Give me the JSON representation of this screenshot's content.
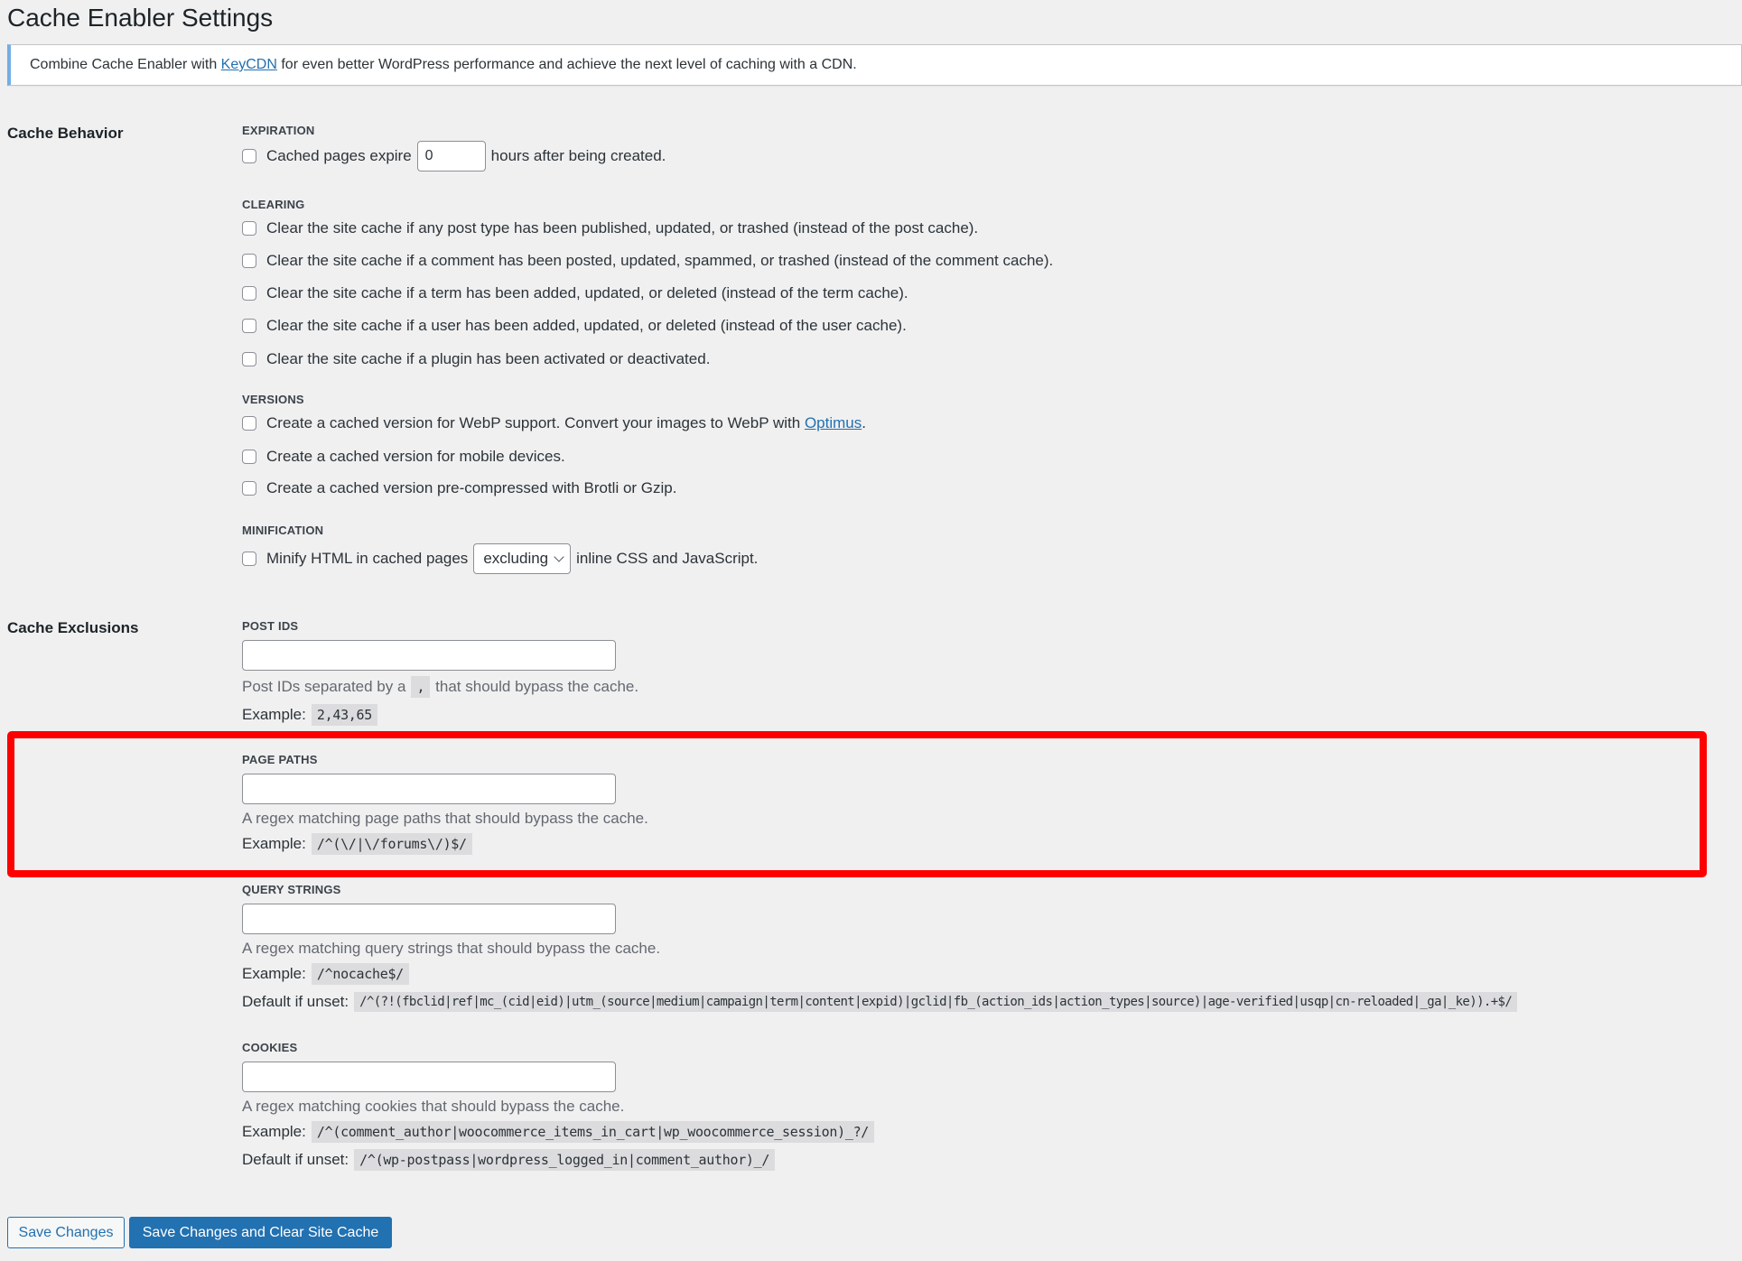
{
  "page": {
    "title": "Cache Enabler Settings"
  },
  "notice": {
    "before": "Combine Cache Enabler with ",
    "link": "KeyCDN",
    "after": " for even better WordPress performance and achieve the next level of caching with a CDN."
  },
  "cache_behavior": {
    "heading": "Cache Behavior",
    "expiration": {
      "label": "EXPIRATION",
      "before": "Cached pages expire",
      "value": "0",
      "after": "hours after being created.",
      "checked": false
    },
    "clearing": {
      "label": "CLEARING",
      "items": [
        {
          "label": "Clear the site cache if any post type has been published, updated, or trashed (instead of the post cache).",
          "checked": false
        },
        {
          "label": "Clear the site cache if a comment has been posted, updated, spammed, or trashed (instead of the comment cache).",
          "checked": false
        },
        {
          "label": "Clear the site cache if a term has been added, updated, or deleted (instead of the term cache).",
          "checked": false
        },
        {
          "label": "Clear the site cache if a user has been added, updated, or deleted (instead of the user cache).",
          "checked": false
        },
        {
          "label": "Clear the site cache if a plugin has been activated or deactivated.",
          "checked": false
        }
      ]
    },
    "versions": {
      "label": "VERSIONS",
      "webp_before": "Create a cached version for WebP support. Convert your images to WebP with ",
      "webp_link": "Optimus",
      "webp_after": ".",
      "mobile": "Create a cached version for mobile devices.",
      "compressed": "Create a cached version pre-compressed with Brotli or Gzip."
    },
    "minification": {
      "label": "MINIFICATION",
      "before": "Minify HTML in cached pages",
      "selected": "excluding",
      "after": "inline CSS and JavaScript.",
      "checked": false
    }
  },
  "cache_exclusions": {
    "heading": "Cache Exclusions",
    "post_ids": {
      "label": "POST IDS",
      "value": "",
      "desc_before": "Post IDs separated by a",
      "separator": ",",
      "desc_after": "that should bypass the cache.",
      "example_label": "Example:",
      "example": "2,43,65"
    },
    "page_paths": {
      "label": "PAGE PATHS",
      "value": "",
      "desc": "A regex matching page paths that should bypass the cache.",
      "example_label": "Example:",
      "example": "/^(\\/|\\/forums\\/)$/"
    },
    "query_strings": {
      "label": "QUERY STRINGS",
      "value": "",
      "desc": "A regex matching query strings that should bypass the cache.",
      "example_label": "Example:",
      "example": "/^nocache$/",
      "default_label": "Default if unset:",
      "default": "/^(?!(fbclid|ref|mc_(cid|eid)|utm_(source|medium|campaign|term|content|expid)|gclid|fb_(action_ids|action_types|source)|age-verified|usqp|cn-reloaded|_ga|_ke)).+$/"
    },
    "cookies": {
      "label": "COOKIES",
      "value": "",
      "desc": "A regex matching cookies that should bypass the cache.",
      "example_label": "Example:",
      "example": "/^(comment_author|woocommerce_items_in_cart|wp_woocommerce_session)_?/",
      "default_label": "Default if unset:",
      "default": "/^(wp-postpass|wordpress_logged_in|comment_author)_/"
    }
  },
  "buttons": {
    "save": "Save Changes",
    "save_clear": "Save Changes and Clear Site Cache"
  },
  "highlight": {
    "color": "#ff0000",
    "target": "page_paths"
  }
}
